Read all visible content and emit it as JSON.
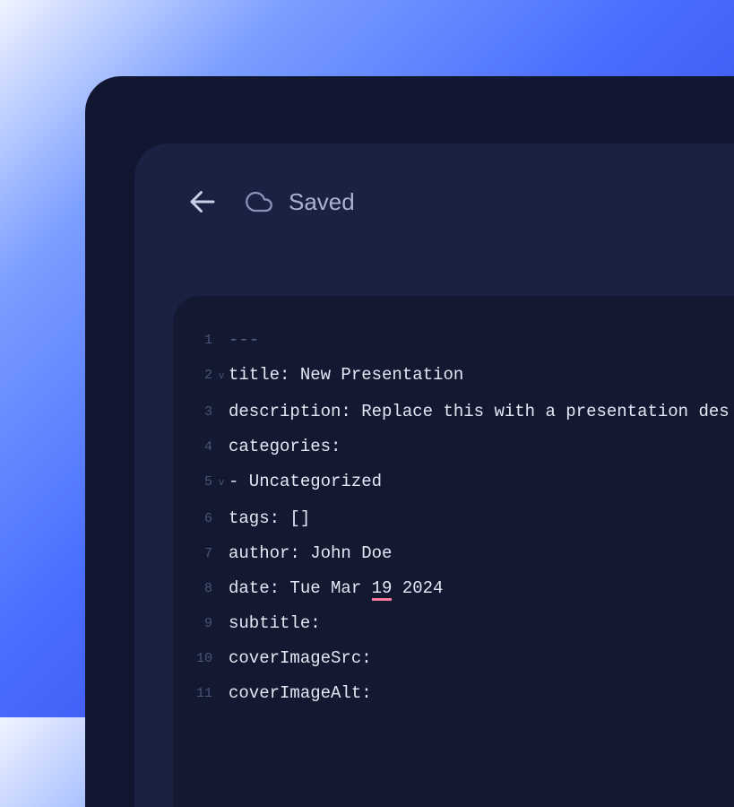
{
  "toolbar": {
    "saved_label": "Saved"
  },
  "editor": {
    "lines": [
      {
        "num": "1",
        "fold": "",
        "content": "---",
        "separator": true
      },
      {
        "num": "2",
        "fold": "v",
        "content": "title: New Presentation"
      },
      {
        "num": "3",
        "fold": "",
        "content": "description: Replace this with a presentation des"
      },
      {
        "num": "4",
        "fold": "",
        "content": "categories:"
      },
      {
        "num": "5",
        "fold": "v",
        "content": "  - Uncategorized"
      },
      {
        "num": "6",
        "fold": "",
        "content": "tags: []"
      },
      {
        "num": "7",
        "fold": "",
        "content": "author: John Doe"
      },
      {
        "num": "8",
        "fold": "",
        "content_before": "date: Tue Mar ",
        "underlined": "19",
        "content_after": " 2024"
      },
      {
        "num": "9",
        "fold": "",
        "content": "subtitle:"
      },
      {
        "num": "10",
        "fold": "",
        "content": "coverImageSrc:"
      },
      {
        "num": "11",
        "fold": "",
        "content": "coverImageAlt:"
      }
    ]
  }
}
